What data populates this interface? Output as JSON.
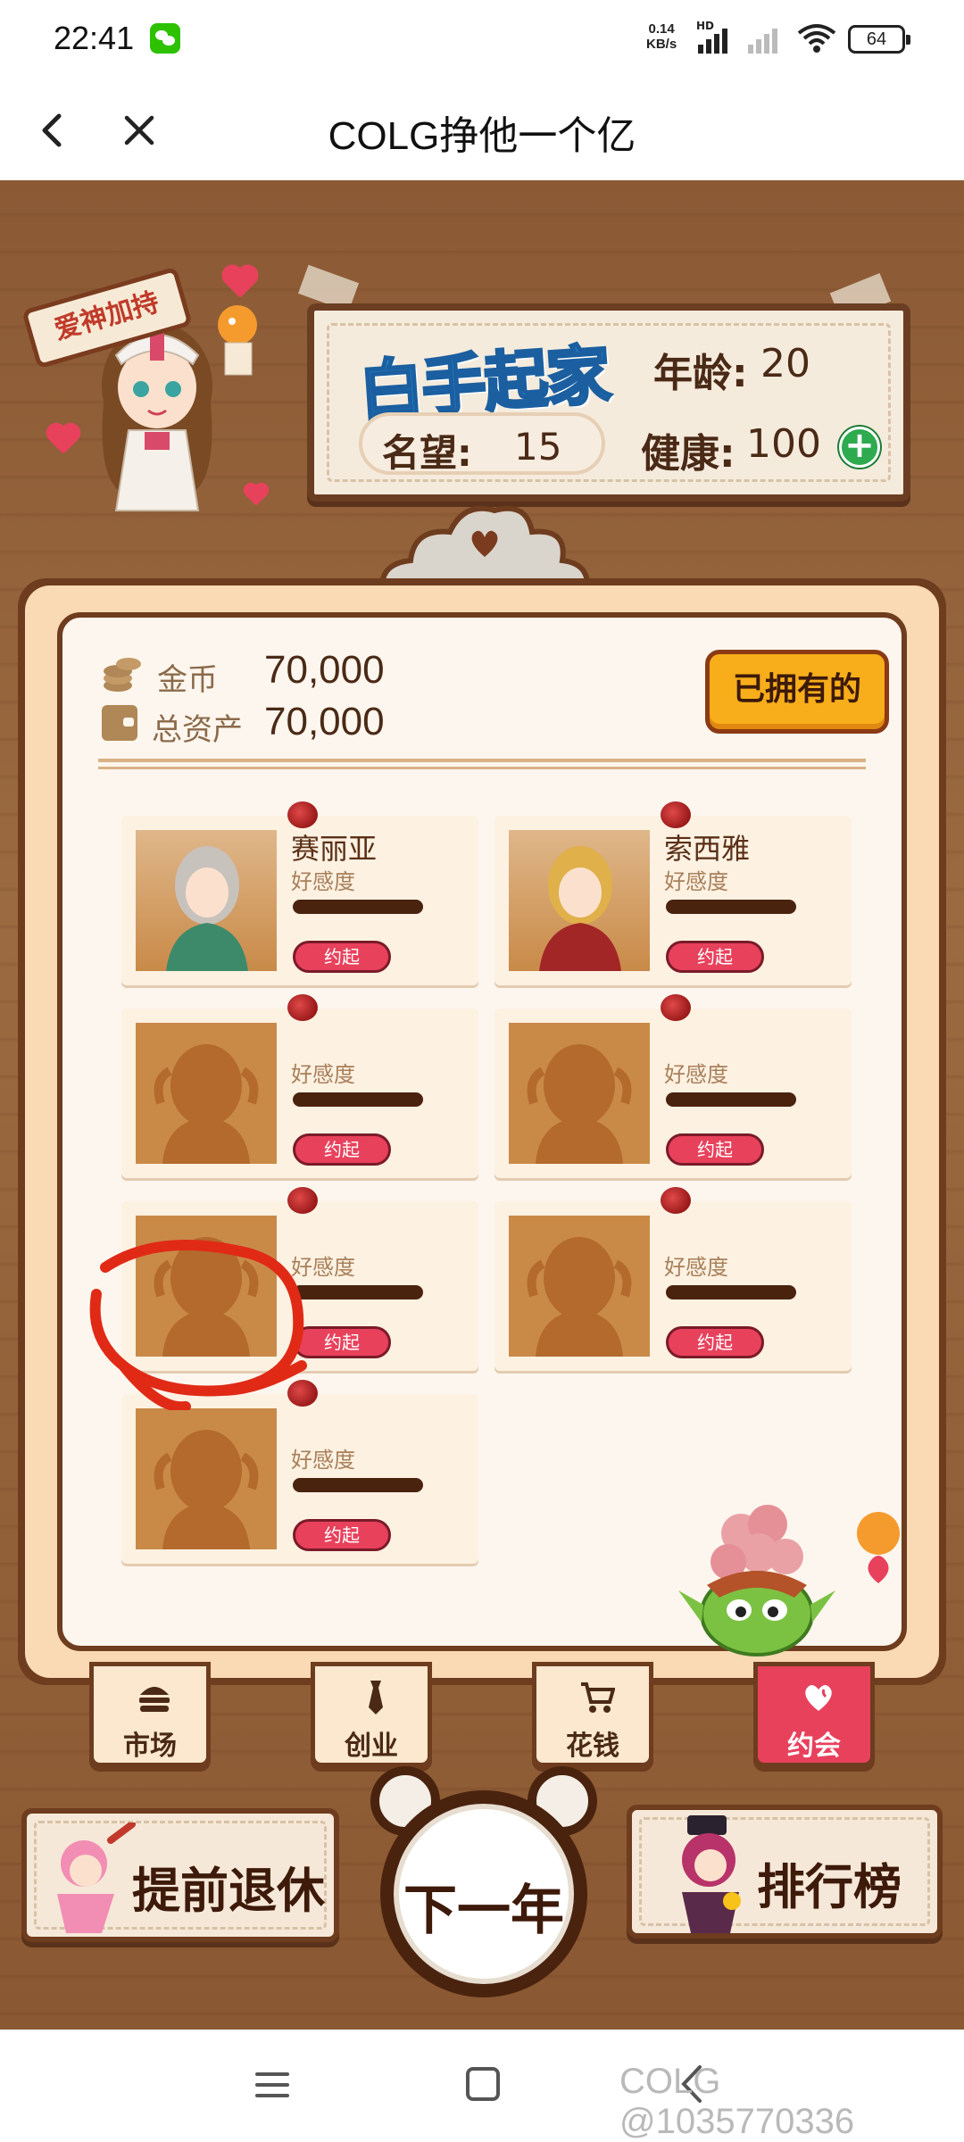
{
  "status_bar": {
    "time": "22:41",
    "net_speed_value": "0.14",
    "net_speed_unit": "KB/s",
    "hd_label": "HD",
    "battery": "64",
    "icons": [
      "wechat-icon",
      "signal-icon",
      "wifi-icon",
      "battery-icon"
    ]
  },
  "title_bar": {
    "title": "COLG挣他一个亿",
    "back_icon": "chevron-left-icon",
    "close_icon": "close-icon"
  },
  "game": {
    "badge": "爱神加持",
    "logo": "白手起家",
    "stats": {
      "age_label": "年龄:",
      "age_value": "20",
      "fame_label": "名望:",
      "fame_value": "15",
      "health_label": "健康:",
      "health_value": "100"
    },
    "money": {
      "gold_label": "金币",
      "gold_value": "70,000",
      "assets_label": "总资产",
      "assets_value": "70,000",
      "owned_button": "已拥有的"
    },
    "characters": [
      {
        "name": "赛丽亚",
        "favor_label": "好感度",
        "favor": 1.0,
        "button": "约起",
        "unlocked": true
      },
      {
        "name": "索西雅",
        "favor_label": "好感度",
        "favor": 1.0,
        "button": "约起",
        "unlocked": true
      },
      {
        "name": "",
        "favor_label": "好感度",
        "favor": 1.0,
        "button": "约起",
        "unlocked": false
      },
      {
        "name": "",
        "favor_label": "好感度",
        "favor": 1.0,
        "button": "约起",
        "unlocked": false
      },
      {
        "name": "",
        "favor_label": "好感度",
        "favor": 1.0,
        "button": "约起",
        "unlocked": false
      },
      {
        "name": "",
        "favor_label": "好感度",
        "favor": 1.0,
        "button": "约起",
        "unlocked": false
      },
      {
        "name": "",
        "favor_label": "好感度",
        "favor": 1.0,
        "button": "约起",
        "unlocked": false
      }
    ],
    "tabs": [
      {
        "label": "市场",
        "icon": "burger-icon",
        "active": false
      },
      {
        "label": "创业",
        "icon": "necktie-icon",
        "active": false
      },
      {
        "label": "花钱",
        "icon": "cart-icon",
        "active": false
      },
      {
        "label": "约会",
        "icon": "hearts-icon",
        "active": true
      }
    ],
    "retire_button": "提前退休",
    "next_year_button": "下一年",
    "ranking_button": "排行榜",
    "colors": {
      "accent_red": "#e8415c",
      "wood": "#8b5a35",
      "gold": "#f7ae1a"
    }
  },
  "nav_bar": {
    "icons": [
      "menu-icon",
      "home-icon",
      "back-icon"
    ],
    "watermark": "COLG @1035770336"
  }
}
